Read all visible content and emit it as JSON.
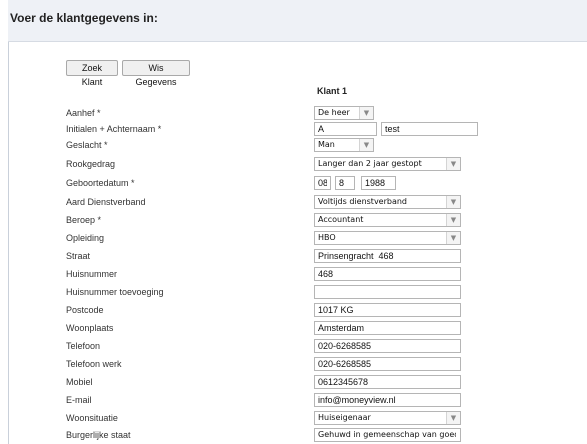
{
  "header": {
    "title": "Voer de klantgegevens in:"
  },
  "toolbar": {
    "zoek_label": "Zoek Klant",
    "wis_label": "Wis Gegevens"
  },
  "column": {
    "title": "Klant 1"
  },
  "fields": {
    "aanhef": {
      "label": "Aanhef *",
      "value": "De heer"
    },
    "initialen": {
      "label": "Initialen + Achternaam *",
      "initialen": "A",
      "achternaam": "test"
    },
    "geslacht": {
      "label": "Geslacht *",
      "value": "Man"
    },
    "rookgedrag": {
      "label": "Rookgedrag",
      "value": "Langer dan 2 jaar gestopt"
    },
    "geboortedatum": {
      "label": "Geboortedatum *",
      "dag": "08",
      "maand": "8",
      "jaar": "1988"
    },
    "dienstverband": {
      "label": "Aard Dienstverband",
      "value": "Voltijds dienstverband"
    },
    "beroep": {
      "label": "Beroep *",
      "value": "Accountant"
    },
    "opleiding": {
      "label": "Opleiding",
      "value": "HBO"
    },
    "straat": {
      "label": "Straat",
      "value": "Prinsengracht  468"
    },
    "huisnummer": {
      "label": "Huisnummer",
      "value": "468"
    },
    "toevoeging": {
      "label": "Huisnummer toevoeging",
      "value": ""
    },
    "postcode": {
      "label": "Postcode",
      "value": "1017 KG"
    },
    "woonplaats": {
      "label": "Woonplaats",
      "value": "Amsterdam"
    },
    "telefoon": {
      "label": "Telefoon",
      "value": "020-6268585"
    },
    "telefoon_werk": {
      "label": "Telefoon werk",
      "value": "020-6268585"
    },
    "mobiel": {
      "label": "Mobiel",
      "value": "0612345678"
    },
    "email": {
      "label": "E-mail",
      "value": "info@moneyview.nl"
    },
    "woonsituatie": {
      "label": "Woonsituatie",
      "value": "Huiseigenaar"
    },
    "burgerlijke_staat": {
      "label": "Burgerlijke staat",
      "value": "Gehuwd in gemeenschap van goederen"
    }
  },
  "icons": {
    "dropdown": "chevron-down-icon"
  }
}
